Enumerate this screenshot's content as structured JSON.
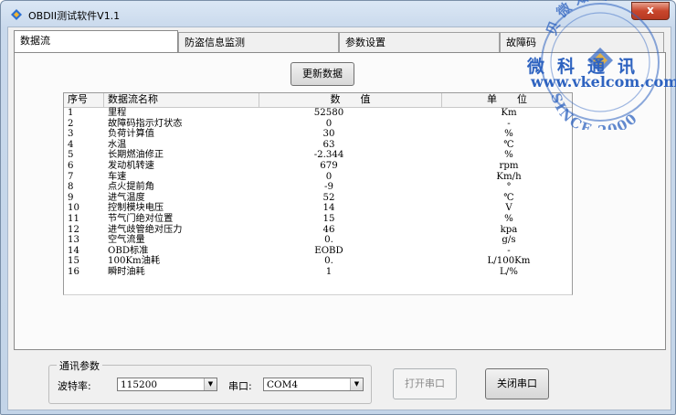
{
  "window": {
    "title": "OBDII测试软件V1.1",
    "close_glyph": "x"
  },
  "tabs": [
    "数据流",
    "防盗信息监测",
    "参数设置",
    "故障码"
  ],
  "refresh_button": "更新数据",
  "table": {
    "headers": [
      "序号",
      "数据流名称",
      "数　　值",
      "单　　位"
    ],
    "rows": [
      {
        "no": "1",
        "name": "里程",
        "value": "52580",
        "unit": "Km"
      },
      {
        "no": "2",
        "name": "故障码指示灯状态",
        "value": "0",
        "unit": "-"
      },
      {
        "no": "3",
        "name": "负荷计算值",
        "value": "30",
        "unit": "%"
      },
      {
        "no": "4",
        "name": "水温",
        "value": "63",
        "unit": "℃"
      },
      {
        "no": "5",
        "name": "长期燃油修正",
        "value": "-2.344",
        "unit": "%"
      },
      {
        "no": "6",
        "name": "发动机转速",
        "value": "679",
        "unit": "rpm"
      },
      {
        "no": "7",
        "name": "车速",
        "value": "0",
        "unit": "Km/h"
      },
      {
        "no": "8",
        "name": "点火提前角",
        "value": "-9",
        "unit": "°"
      },
      {
        "no": "9",
        "name": "进气温度",
        "value": "52",
        "unit": "℃"
      },
      {
        "no": "10",
        "name": "控制模块电压",
        "value": "14",
        "unit": "V"
      },
      {
        "no": "11",
        "name": "节气门绝对位置",
        "value": "15",
        "unit": "%"
      },
      {
        "no": "12",
        "name": "进气歧管绝对压力",
        "value": "46",
        "unit": "kpa"
      },
      {
        "no": "13",
        "name": "空气流量",
        "value": "0.",
        "unit": "g/s"
      },
      {
        "no": "14",
        "name": "OBD标准",
        "value": "EOBD",
        "unit": "-"
      },
      {
        "no": "15",
        "name": "100Km油耗",
        "value": "0.",
        "unit": "L/100Km"
      },
      {
        "no": "16",
        "name": "瞬时油耗",
        "value": "1",
        "unit": "L/%"
      }
    ]
  },
  "comm": {
    "legend": "通讯参数",
    "baud_label": "波特率:",
    "baud_value": "115200",
    "port_label": "串口:",
    "port_value": "COM4"
  },
  "buttons": {
    "open_port": "打开串口",
    "close_port": "关闭串口"
  },
  "watermark": {
    "ring_top": "贝微知著",
    "chinese": "微科通讯",
    "url": "www.vkelcom.com",
    "since": "SINCE 2000",
    "color": "#2e63c0"
  }
}
